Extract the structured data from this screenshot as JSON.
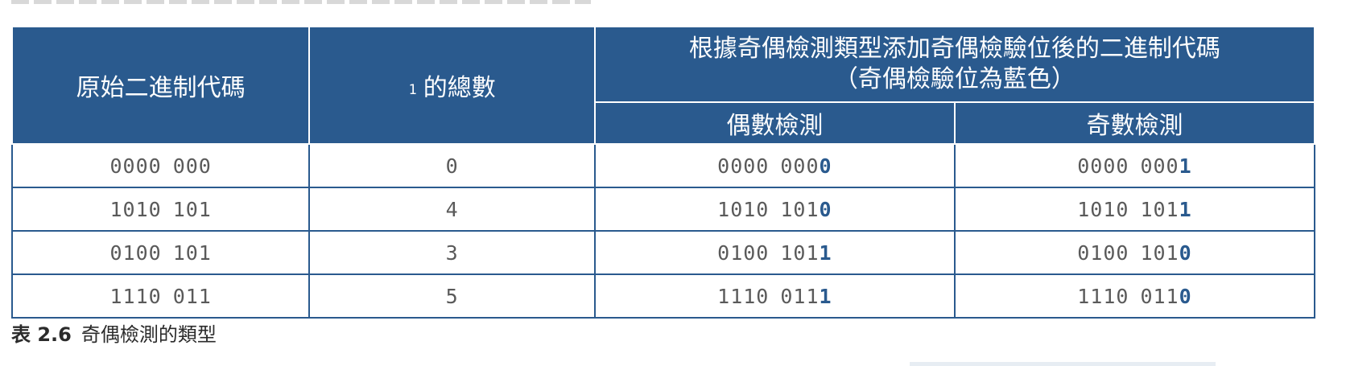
{
  "table": {
    "headers": {
      "original": "原始二進制代碼",
      "count_one": "1",
      "count_label": "的總數",
      "group_line1": "根據奇偶檢測類型添加奇偶檢驗位後的二進制代碼",
      "group_line2": "（奇偶檢驗位為藍色）",
      "even": "偶數檢測",
      "odd": "奇數檢測"
    },
    "rows": [
      {
        "orig_a": "0000",
        "orig_b": "000",
        "count": "0",
        "even_a": "0000",
        "even_b": "000",
        "even_bit": "0",
        "odd_a": "0000",
        "odd_b": "000",
        "odd_bit": "1"
      },
      {
        "orig_a": "1010",
        "orig_b": "101",
        "count": "4",
        "even_a": "1010",
        "even_b": "101",
        "even_bit": "0",
        "odd_a": "1010",
        "odd_b": "101",
        "odd_bit": "1"
      },
      {
        "orig_a": "0100",
        "orig_b": "101",
        "count": "3",
        "even_a": "0100",
        "even_b": "101",
        "even_bit": "1",
        "odd_a": "0100",
        "odd_b": "101",
        "odd_bit": "0"
      },
      {
        "orig_a": "1110",
        "orig_b": "011",
        "count": "5",
        "even_a": "1110",
        "even_b": "011",
        "even_bit": "1",
        "odd_a": "1110",
        "odd_b": "011",
        "odd_bit": "0"
      }
    ]
  },
  "caption": {
    "number": "表 2.6",
    "text": "奇偶檢測的類型"
  },
  "colors": {
    "header_bg": "#2a5a8e",
    "parity_bit": "#2a5a8e",
    "digits": "#5a5a5a"
  }
}
